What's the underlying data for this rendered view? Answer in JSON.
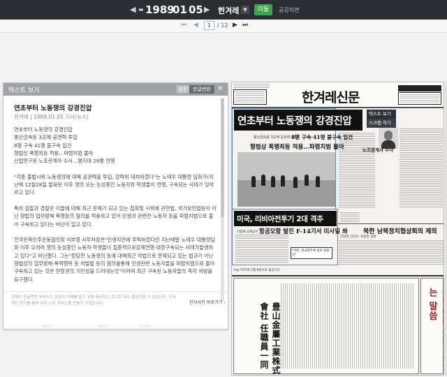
{
  "header": {
    "year": "1989",
    "month": "01",
    "day": "05",
    "paper": "한겨레",
    "go_label": "이동",
    "share_label": "공감지면"
  },
  "pager": {
    "current": "1",
    "total": "/ 12"
  },
  "text_panel": {
    "title": "텍스트 보기",
    "tab_original": "원문",
    "tab_converted": "한글변환",
    "article_title": "연초부터 노동쟁의 강경진압",
    "article_meta": "한겨레 | 1989.01.05 기사(뉴스)",
    "paragraphs": [
      "연초부터 노동쟁의 강경진압\n풍산금속등 3곳에 공권력 투입\n8명 구속 41명 불구속 입건\n형법상 폭행죄등 적용…파렴치범 몰아\n산업연구원 노조관계자 수사…명지대 29명 연행",
      "\"각종 불법시위 노동쟁의에 대해 공권력을 투입, 강력히 대처하겠다\"는 노태우 대통령 담화가(지난해 12월28일 발표된 이후 쟁의 또는 농성중인 노동자와 학생들이 연행, 구속되는 사태가 잇따르고 있다.",
      "특히 검찰과 경찰은 이들에 대해 최근 문제가 되고 있는 집회및 시위에 관한법, 국가보안법등이 아닌 형법의 업무방해 폭행등의 혐의를 적용하고 있어 민생과 관련한 노동자 등을 파렴치범으로 몰아 구속하고 있다는 비난이 일고 있다.",
      "전국민족민주운동협의회 이부영 사무처장은\"민생치안에 주력하겠다던 지난해말 노태우 대통령담화 이후 오히려 쟁의 농성중인 노동자·학생들이 집중적으로강제연행·대량구속되는 사태가발생하고 있다\"고 비난했다. 그는\"정당한 노동쟁의 등에 대해최근 악법으로 문제되고 있는 법규가 아닌 형법상의 업무방해·폭력행위 등 처벌법 등의 혐의를통해 민생관련 노동자들을 파렴치범으로 몰아 구속하고 있는 것은 현정권의 기만성을 드러내는것\"이라며 최근 구속된 노동자들의 즉각 석방을 요구했다."
    ],
    "footnote": "현재의 한글변환 서비스는 원문의 이해를 돕기 위해 제공되는 것으로 다소 불완전할 수 있습니다. 지속적인 연구를 통해 보다 나은 서비스를 만들어 가겠습니다.",
    "footer_link": "한자사전 바로가기 ›"
  },
  "newspaper": {
    "masthead": "한겨레신문",
    "headline_main": "연초부터 노동쟁의 강경진압",
    "sub_a": "풍산금속등 3곳에 공권력 투입",
    "sub_b": "8명 구속·41명 불구속 입건",
    "sub_c": "형법상 폭행죄등 적용…파렴치범 몰아",
    "sub_d": "노조관계자 수사",
    "headline_second": "미국, 리비아전투기 2대 격추",
    "sub_e": "지중해 공해상서",
    "sub_f": "항공모함 발진 F-14기서 미사일 쏴",
    "headline_third": "북한 남북정치협상회의 제의",
    "sub_g": "김일성 신년사 ·김종일 집회",
    "ad_small": "\"이번, 한국정부에 실수 않을것\"",
    "tv_line": "오늘 TV프로그램 8면으로 옮깁니다",
    "ad_vertical": "豊山金屬工業株式會社 任職員一同",
    "ad_right": "국민여러분께 드리는 말씀",
    "tool_view_text": "텍스트 보기",
    "tool_scrap": "스크랩 하기"
  },
  "background_labels": [
    "NAVER",
    "NAVER",
    "NAVER"
  ]
}
